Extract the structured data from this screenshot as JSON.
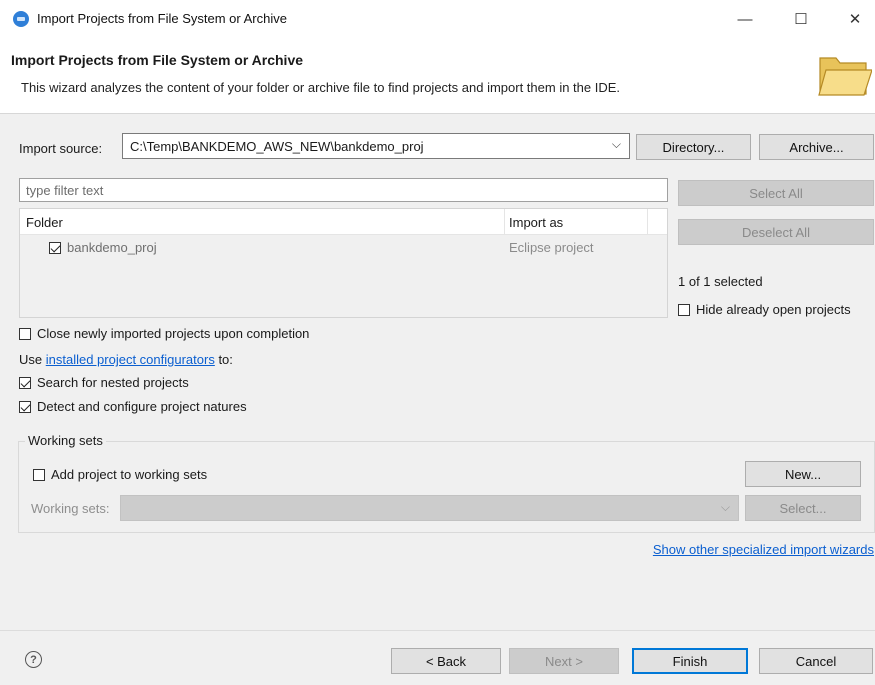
{
  "window": {
    "title": "Import Projects from File System or Archive",
    "minimize_glyph": "—",
    "maximize_glyph": "☐",
    "close_glyph": "✕"
  },
  "header": {
    "title": "Import Projects from File System or Archive",
    "description": "This wizard analyzes the content of your folder or archive file to find projects and import them in the IDE."
  },
  "import_source": {
    "label": "Import source:",
    "value": "C:\\Temp\\BANKDEMO_AWS_NEW\\bankdemo_proj",
    "directory_button": "Directory...",
    "archive_button": "Archive..."
  },
  "filter": {
    "placeholder": "type filter text"
  },
  "table": {
    "columns": [
      "Folder",
      "Import as"
    ],
    "rows": [
      {
        "folder": "bankdemo_proj",
        "import_as": "Eclipse project",
        "checked": true
      }
    ]
  },
  "side": {
    "select_all": "Select All",
    "deselect_all": "Deselect All",
    "selected_count": "1 of 1 selected",
    "hide_open": "Hide already open projects"
  },
  "options": {
    "close_imported": "Close newly imported projects upon completion",
    "use_prefix": "Use ",
    "configurators_link": "installed project configurators",
    "use_suffix": " to:",
    "search_nested": "Search for nested projects",
    "detect_natures": "Detect and configure project natures"
  },
  "working_sets": {
    "group_label": "Working sets",
    "add_label": "Add project to working sets",
    "new_button": "New...",
    "sets_label": "Working sets:",
    "select_button": "Select..."
  },
  "other_wizards_link": "Show other specialized import wizards",
  "footer": {
    "help_glyph": "?",
    "back": "< Back",
    "next": "Next >",
    "finish": "Finish",
    "cancel": "Cancel"
  },
  "colors": {
    "link": "#0b5fd0",
    "default_button_border": "#0078d7"
  },
  "icons": [
    "app-icon",
    "folder-icon",
    "help-icon",
    "chevron-down-icon"
  ]
}
